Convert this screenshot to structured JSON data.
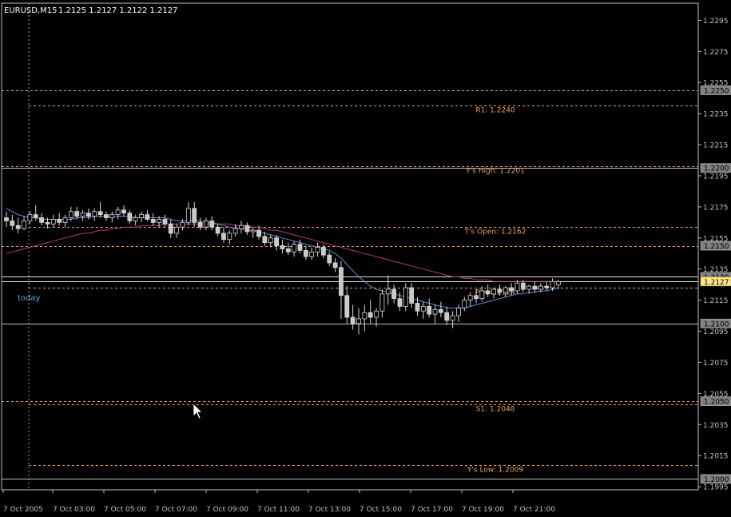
{
  "header": {
    "symbol": "EURUSD,M15",
    "ohlc": "1.2125 1.2127 1.2122 1.2127"
  },
  "colors": {
    "background": "#000000",
    "axis": "#c0c0c0",
    "candle_up_fill": "#000000",
    "candle_up_stroke": "#d8d8d8",
    "candle_down_fill": "#c8c8c8",
    "wick": "#d8d8d8",
    "level_orange": "#e8a060",
    "level_gray": "#c0c0c0",
    "ma_fast": "#5b8fd0",
    "ma_slow": "#b0406a",
    "current_price_badge": "#ffe890",
    "today_label": "#5ba6c8"
  },
  "today_label": "today",
  "chart_data": {
    "type": "candlestick",
    "yticks": [
      "1.2295",
      "1.2275",
      "1.2255",
      "1.2235",
      "1.2215",
      "1.2195",
      "1.2175",
      "1.2155",
      "1.2135",
      "1.2115",
      "1.2095",
      "1.2075",
      "1.2055",
      "1.2035",
      "1.2015",
      "1.1995"
    ],
    "ylim": [
      1.1993,
      1.2306
    ],
    "xticks": [
      "7 Oct 2005",
      "7 Oct 03:00",
      "7 Oct 05:00",
      "7 Oct 07:00",
      "7 Oct 09:00",
      "7 Oct 11:00",
      "7 Oct 13:00",
      "7 Oct 15:00",
      "7 Oct 17:00",
      "7 Oct 19:00",
      "7 Oct 21:00"
    ],
    "axis_badges": [
      {
        "value": 1.225,
        "text": "1.2250",
        "style": "gray"
      },
      {
        "value": 1.22,
        "text": "1.2200",
        "style": "gray"
      },
      {
        "value": 1.215,
        "text": "1.2150",
        "style": "gray"
      },
      {
        "value": 1.213,
        "text": "1.2130",
        "style": "gray"
      },
      {
        "value": 1.2127,
        "text": "1.2127",
        "style": "current"
      },
      {
        "value": 1.21,
        "text": "1.2100",
        "style": "gray"
      },
      {
        "value": 1.205,
        "text": "1.2050",
        "style": "gray"
      },
      {
        "value": 1.2,
        "text": "1.2000",
        "style": "gray"
      }
    ],
    "levels": [
      {
        "value": 1.225,
        "style": "orange_dash",
        "label": "",
        "from": "left"
      },
      {
        "value": 1.224,
        "style": "orange_dash",
        "label": "R1: 1.2240",
        "from": "today"
      },
      {
        "value": 1.2201,
        "style": "orange_dash",
        "label": "Y's High: 1.2201",
        "from": "left"
      },
      {
        "value": 1.22,
        "style": "gray_solid",
        "label": "",
        "from": "left"
      },
      {
        "value": 1.2162,
        "style": "orange_dash",
        "label": "T's Open: 1.2162",
        "from": "today"
      },
      {
        "value": 1.215,
        "style": "orange_dash",
        "label": "",
        "from": "left"
      },
      {
        "value": 1.213,
        "style": "white_solid",
        "label": "",
        "from": "left"
      },
      {
        "value": 1.2127,
        "style": "white_solid",
        "label": "",
        "from": "left"
      },
      {
        "value": 1.2123,
        "style": "orange_dash",
        "label": "Piv: 1.2124",
        "from": "today"
      },
      {
        "value": 1.21,
        "style": "gray_solid",
        "label": "",
        "from": "left"
      },
      {
        "value": 1.205,
        "style": "orange_dash",
        "label": "",
        "from": "left"
      },
      {
        "value": 1.2048,
        "style": "orange_dash",
        "label": "S1: 1.2048",
        "from": "today"
      },
      {
        "value": 1.2009,
        "style": "orange_dash",
        "label": "Y's Low: 1.2009",
        "from": "today"
      },
      {
        "value": 1.2,
        "style": "gray_solid",
        "label": "",
        "from": "left"
      }
    ],
    "candles": [
      {
        "o": 1.2168,
        "h": 1.2172,
        "l": 1.2162,
        "c": 1.2166
      },
      {
        "o": 1.2166,
        "h": 1.217,
        "l": 1.216,
        "c": 1.2163
      },
      {
        "o": 1.2163,
        "h": 1.2168,
        "l": 1.2158,
        "c": 1.2161
      },
      {
        "o": 1.2161,
        "h": 1.2169,
        "l": 1.216,
        "c": 1.2166
      },
      {
        "o": 1.2166,
        "h": 1.2172,
        "l": 1.2164,
        "c": 1.217
      },
      {
        "o": 1.217,
        "h": 1.2176,
        "l": 1.2166,
        "c": 1.2168
      },
      {
        "o": 1.2168,
        "h": 1.2171,
        "l": 1.2163,
        "c": 1.2165
      },
      {
        "o": 1.2165,
        "h": 1.2168,
        "l": 1.2161,
        "c": 1.2164
      },
      {
        "o": 1.2164,
        "h": 1.217,
        "l": 1.2162,
        "c": 1.2167
      },
      {
        "o": 1.2167,
        "h": 1.2171,
        "l": 1.2163,
        "c": 1.2165
      },
      {
        "o": 1.2165,
        "h": 1.217,
        "l": 1.2162,
        "c": 1.2168
      },
      {
        "o": 1.2168,
        "h": 1.2175,
        "l": 1.2166,
        "c": 1.2172
      },
      {
        "o": 1.2172,
        "h": 1.2175,
        "l": 1.2167,
        "c": 1.2169
      },
      {
        "o": 1.2169,
        "h": 1.2173,
        "l": 1.2166,
        "c": 1.2171
      },
      {
        "o": 1.2171,
        "h": 1.2174,
        "l": 1.2167,
        "c": 1.2169
      },
      {
        "o": 1.2169,
        "h": 1.2174,
        "l": 1.2166,
        "c": 1.2172
      },
      {
        "o": 1.2172,
        "h": 1.2178,
        "l": 1.2168,
        "c": 1.217
      },
      {
        "o": 1.217,
        "h": 1.2172,
        "l": 1.2166,
        "c": 1.2168
      },
      {
        "o": 1.2168,
        "h": 1.2172,
        "l": 1.2165,
        "c": 1.217
      },
      {
        "o": 1.217,
        "h": 1.2175,
        "l": 1.2167,
        "c": 1.2173
      },
      {
        "o": 1.2173,
        "h": 1.2176,
        "l": 1.2169,
        "c": 1.2171
      },
      {
        "o": 1.2171,
        "h": 1.2173,
        "l": 1.2164,
        "c": 1.2166
      },
      {
        "o": 1.2166,
        "h": 1.217,
        "l": 1.2163,
        "c": 1.2168
      },
      {
        "o": 1.2168,
        "h": 1.2172,
        "l": 1.2165,
        "c": 1.217
      },
      {
        "o": 1.217,
        "h": 1.2173,
        "l": 1.2166,
        "c": 1.2167
      },
      {
        "o": 1.2167,
        "h": 1.2171,
        "l": 1.2163,
        "c": 1.2165
      },
      {
        "o": 1.2165,
        "h": 1.2169,
        "l": 1.2162,
        "c": 1.2167
      },
      {
        "o": 1.2167,
        "h": 1.217,
        "l": 1.2162,
        "c": 1.2164
      },
      {
        "o": 1.2164,
        "h": 1.2167,
        "l": 1.2155,
        "c": 1.2158
      },
      {
        "o": 1.2158,
        "h": 1.2164,
        "l": 1.2155,
        "c": 1.2162
      },
      {
        "o": 1.2162,
        "h": 1.2167,
        "l": 1.216,
        "c": 1.2165
      },
      {
        "o": 1.2165,
        "h": 1.2178,
        "l": 1.2163,
        "c": 1.2174
      },
      {
        "o": 1.2174,
        "h": 1.2178,
        "l": 1.2162,
        "c": 1.2165
      },
      {
        "o": 1.2165,
        "h": 1.2168,
        "l": 1.216,
        "c": 1.2162
      },
      {
        "o": 1.2162,
        "h": 1.2168,
        "l": 1.216,
        "c": 1.2166
      },
      {
        "o": 1.2166,
        "h": 1.2169,
        "l": 1.216,
        "c": 1.2162
      },
      {
        "o": 1.2162,
        "h": 1.2164,
        "l": 1.2156,
        "c": 1.2158
      },
      {
        "o": 1.2158,
        "h": 1.2162,
        "l": 1.2152,
        "c": 1.2154
      },
      {
        "o": 1.2154,
        "h": 1.216,
        "l": 1.2151,
        "c": 1.2158
      },
      {
        "o": 1.2158,
        "h": 1.2164,
        "l": 1.2156,
        "c": 1.2161
      },
      {
        "o": 1.2161,
        "h": 1.2166,
        "l": 1.2158,
        "c": 1.2163
      },
      {
        "o": 1.2163,
        "h": 1.2165,
        "l": 1.2157,
        "c": 1.2159
      },
      {
        "o": 1.2159,
        "h": 1.2162,
        "l": 1.2155,
        "c": 1.216
      },
      {
        "o": 1.216,
        "h": 1.2163,
        "l": 1.2154,
        "c": 1.2156
      },
      {
        "o": 1.2156,
        "h": 1.2159,
        "l": 1.215,
        "c": 1.2152
      },
      {
        "o": 1.2152,
        "h": 1.2157,
        "l": 1.2149,
        "c": 1.2155
      },
      {
        "o": 1.2155,
        "h": 1.2157,
        "l": 1.2147,
        "c": 1.215
      },
      {
        "o": 1.215,
        "h": 1.2154,
        "l": 1.2145,
        "c": 1.2148
      },
      {
        "o": 1.2148,
        "h": 1.2152,
        "l": 1.2144,
        "c": 1.2146
      },
      {
        "o": 1.2146,
        "h": 1.2153,
        "l": 1.2143,
        "c": 1.2151
      },
      {
        "o": 1.2151,
        "h": 1.2154,
        "l": 1.2145,
        "c": 1.2147
      },
      {
        "o": 1.2147,
        "h": 1.215,
        "l": 1.2141,
        "c": 1.2143
      },
      {
        "o": 1.2143,
        "h": 1.2149,
        "l": 1.2141,
        "c": 1.2146
      },
      {
        "o": 1.2146,
        "h": 1.2152,
        "l": 1.2143,
        "c": 1.2149
      },
      {
        "o": 1.2149,
        "h": 1.2151,
        "l": 1.2142,
        "c": 1.2144
      },
      {
        "o": 1.2144,
        "h": 1.2146,
        "l": 1.2137,
        "c": 1.2139
      },
      {
        "o": 1.2139,
        "h": 1.2142,
        "l": 1.2133,
        "c": 1.2136
      },
      {
        "o": 1.2136,
        "h": 1.214,
        "l": 1.2103,
        "c": 1.2118
      },
      {
        "o": 1.2118,
        "h": 1.2124,
        "l": 1.21,
        "c": 1.2104
      },
      {
        "o": 1.2104,
        "h": 1.2112,
        "l": 1.2096,
        "c": 1.21
      },
      {
        "o": 1.21,
        "h": 1.211,
        "l": 1.2093,
        "c": 1.2103
      },
      {
        "o": 1.2103,
        "h": 1.2112,
        "l": 1.2095,
        "c": 1.2107
      },
      {
        "o": 1.2107,
        "h": 1.2115,
        "l": 1.21,
        "c": 1.2104
      },
      {
        "o": 1.2104,
        "h": 1.211,
        "l": 1.2098,
        "c": 1.2108
      },
      {
        "o": 1.2108,
        "h": 1.2122,
        "l": 1.2104,
        "c": 1.2119
      },
      {
        "o": 1.2119,
        "h": 1.2131,
        "l": 1.2112,
        "c": 1.2122
      },
      {
        "o": 1.2122,
        "h": 1.2125,
        "l": 1.2113,
        "c": 1.2116
      },
      {
        "o": 1.2116,
        "h": 1.212,
        "l": 1.2108,
        "c": 1.2111
      },
      {
        "o": 1.2111,
        "h": 1.2126,
        "l": 1.2108,
        "c": 1.2123
      },
      {
        "o": 1.2123,
        "h": 1.2126,
        "l": 1.211,
        "c": 1.2113
      },
      {
        "o": 1.2113,
        "h": 1.2117,
        "l": 1.2105,
        "c": 1.2108
      },
      {
        "o": 1.2108,
        "h": 1.2114,
        "l": 1.2103,
        "c": 1.2111
      },
      {
        "o": 1.2111,
        "h": 1.2116,
        "l": 1.2104,
        "c": 1.2106
      },
      {
        "o": 1.2106,
        "h": 1.2112,
        "l": 1.21,
        "c": 1.2109
      },
      {
        "o": 1.2109,
        "h": 1.2114,
        "l": 1.2104,
        "c": 1.2107
      },
      {
        "o": 1.2107,
        "h": 1.2111,
        "l": 1.2099,
        "c": 1.2102
      },
      {
        "o": 1.2102,
        "h": 1.2108,
        "l": 1.2097,
        "c": 1.2105
      },
      {
        "o": 1.2105,
        "h": 1.2112,
        "l": 1.2101,
        "c": 1.211
      },
      {
        "o": 1.211,
        "h": 1.2117,
        "l": 1.2108,
        "c": 1.2115
      },
      {
        "o": 1.2115,
        "h": 1.212,
        "l": 1.2111,
        "c": 1.2118
      },
      {
        "o": 1.2118,
        "h": 1.2122,
        "l": 1.2113,
        "c": 1.2116
      },
      {
        "o": 1.2116,
        "h": 1.2124,
        "l": 1.2114,
        "c": 1.2121
      },
      {
        "o": 1.2121,
        "h": 1.2125,
        "l": 1.2117,
        "c": 1.2119
      },
      {
        "o": 1.2119,
        "h": 1.2123,
        "l": 1.2116,
        "c": 1.2122
      },
      {
        "o": 1.2122,
        "h": 1.2125,
        "l": 1.2118,
        "c": 1.212
      },
      {
        "o": 1.212,
        "h": 1.2124,
        "l": 1.2117,
        "c": 1.2123
      },
      {
        "o": 1.2123,
        "h": 1.2126,
        "l": 1.2118,
        "c": 1.2121
      },
      {
        "o": 1.2121,
        "h": 1.2128,
        "l": 1.2119,
        "c": 1.2126
      },
      {
        "o": 1.2126,
        "h": 1.2128,
        "l": 1.212,
        "c": 1.2122
      },
      {
        "o": 1.2122,
        "h": 1.2125,
        "l": 1.2119,
        "c": 1.2124
      },
      {
        "o": 1.2124,
        "h": 1.2127,
        "l": 1.212,
        "c": 1.2122
      },
      {
        "o": 1.2122,
        "h": 1.2126,
        "l": 1.212,
        "c": 1.2124
      },
      {
        "o": 1.2124,
        "h": 1.2127,
        "l": 1.2121,
        "c": 1.2123
      },
      {
        "o": 1.2123,
        "h": 1.2129,
        "l": 1.2121,
        "c": 1.2127
      },
      {
        "o": 1.2125,
        "h": 1.2128,
        "l": 1.2122,
        "c": 1.2127
      }
    ],
    "ma_fast": [
      1.2174,
      1.2172,
      1.217,
      1.2169,
      1.2168,
      1.2168,
      1.2167,
      1.2167,
      1.2167,
      1.2167,
      1.2167,
      1.2167,
      1.2168,
      1.2168,
      1.2168,
      1.2169,
      1.2169,
      1.2169,
      1.2169,
      1.2169,
      1.2169,
      1.2169,
      1.2168,
      1.2168,
      1.2168,
      1.2168,
      1.2168,
      1.2168,
      1.2167,
      1.2166,
      1.2166,
      1.2166,
      1.2166,
      1.2166,
      1.2165,
      1.2165,
      1.2164,
      1.2163,
      1.2162,
      1.2161,
      1.2161,
      1.216,
      1.216,
      1.2159,
      1.2158,
      1.2157,
      1.2156,
      1.2155,
      1.2154,
      1.2153,
      1.2152,
      1.2151,
      1.215,
      1.2149,
      1.2148,
      1.2147,
      1.2145,
      1.2142,
      1.2138,
      1.2134,
      1.213,
      1.2127,
      1.2124,
      1.2122,
      1.2121,
      1.212,
      1.2119,
      1.2118,
      1.2117,
      1.2116,
      1.2115,
      1.2114,
      1.2113,
      1.2112,
      1.2111,
      1.211,
      1.211,
      1.211,
      1.211,
      1.2111,
      1.2112,
      1.2113,
      1.2114,
      1.2115,
      1.2116,
      1.2117,
      1.2118,
      1.2119,
      1.2119,
      1.212,
      1.212,
      1.2121,
      1.2121,
      1.2122,
      1.2123
    ],
    "ma_slow": [
      1.2145,
      1.2146,
      1.2147,
      1.2148,
      1.2149,
      1.215,
      1.2151,
      1.2152,
      1.2153,
      1.2154,
      1.2155,
      1.2156,
      1.2157,
      1.2158,
      1.2158,
      1.2159,
      1.216,
      1.216,
      1.2161,
      1.2161,
      1.2162,
      1.2162,
      1.2162,
      1.2163,
      1.2163,
      1.2163,
      1.2163,
      1.2164,
      1.2164,
      1.2164,
      1.2164,
      1.2164,
      1.2164,
      1.2164,
      1.2164,
      1.2164,
      1.2164,
      1.2164,
      1.2164,
      1.2163,
      1.2163,
      1.2163,
      1.2162,
      1.2162,
      1.2161,
      1.216,
      1.216,
      1.2159,
      1.2158,
      1.2157,
      1.2156,
      1.2155,
      1.2154,
      1.2153,
      1.2152,
      1.2151,
      1.215,
      1.2149,
      1.2148,
      1.2147,
      1.2146,
      1.2145,
      1.2144,
      1.2143,
      1.2142,
      1.2141,
      1.214,
      1.2139,
      1.2138,
      1.2137,
      1.2136,
      1.2135,
      1.2134,
      1.2133,
      1.2132,
      1.2131,
      1.213,
      1.213,
      1.2129,
      1.2129,
      1.2128,
      1.2128,
      1.2128,
      1.2127,
      1.2127,
      1.2127,
      1.2127,
      1.2127,
      1.2127,
      1.2127,
      1.2127,
      1.2127,
      1.2127,
      1.2127,
      1.2127
    ]
  }
}
